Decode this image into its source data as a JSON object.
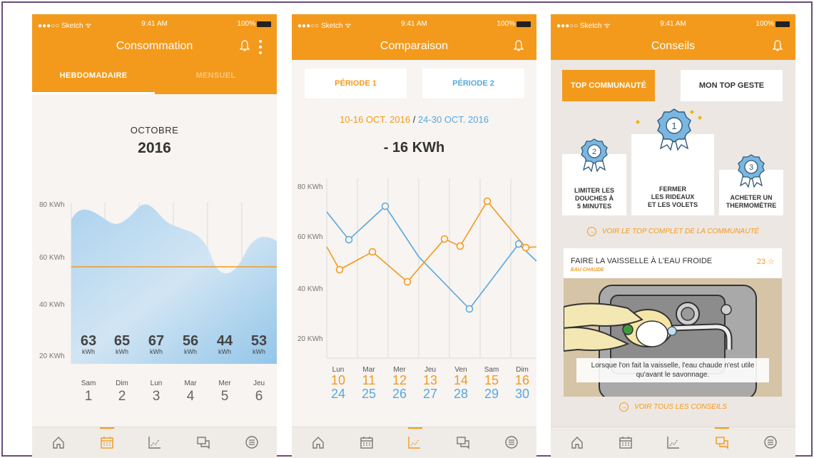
{
  "status_bar": {
    "carrier": "●●●○○ Sketch ᯤ",
    "time": "9:41 AM",
    "battery": "100%"
  },
  "screen1": {
    "title": "Consommation",
    "tab_weekly": "HEBDOMADAIRE",
    "tab_monthly": "MENSUEL",
    "month": "OCTOBRE",
    "year": "2016",
    "y_labels": [
      "80 KWh",
      "60 KWh",
      "40 KWh",
      "20 KWh"
    ],
    "values": [
      {
        "n": "63",
        "u": "kWh"
      },
      {
        "n": "65",
        "u": "kWh"
      },
      {
        "n": "67",
        "u": "kWh"
      },
      {
        "n": "56",
        "u": "kWh"
      },
      {
        "n": "44",
        "u": "kWh"
      },
      {
        "n": "53",
        "u": "kWh"
      }
    ],
    "days": [
      {
        "d": "Sam",
        "n": "1"
      },
      {
        "d": "Dim",
        "n": "2"
      },
      {
        "d": "Lun",
        "n": "3"
      },
      {
        "d": "Mar",
        "n": "4"
      },
      {
        "d": "Mer",
        "n": "5"
      },
      {
        "d": "Jeu",
        "n": "6"
      }
    ]
  },
  "screen2": {
    "title": "Comparaison",
    "period1": "PÉRIODE 1",
    "period2": "PÉRIODE 2",
    "date1": "10-16 OCT. 2016",
    "sep": " / ",
    "date2": "24-30 OCT. 2016",
    "delta": "- 16 KWh",
    "y_labels": [
      "80 KWh",
      "60 KWh",
      "40 KWh",
      "20 KWh"
    ],
    "days": [
      {
        "d": "Lun",
        "a": "10",
        "b": "24"
      },
      {
        "d": "Mar",
        "a": "11",
        "b": "25"
      },
      {
        "d": "Mer",
        "a": "12",
        "b": "26"
      },
      {
        "d": "Jeu",
        "a": "13",
        "b": "27"
      },
      {
        "d": "Ven",
        "a": "14",
        "b": "28"
      },
      {
        "d": "Sam",
        "a": "15",
        "b": "29"
      },
      {
        "d": "Dim",
        "a": "16",
        "b": "30"
      }
    ]
  },
  "screen3": {
    "title": "Conseils",
    "btn_top_community": "TOP COMMUNAUTÉ",
    "btn_my_top": "MON TOP GESTE",
    "rank1": "1",
    "rank2": "2",
    "rank3": "3",
    "card1": "FERMER\nLES RIDEAUX\nET LES VOLETS",
    "card2": "LIMITER LES\nDOUCHES À\n5 MINUTES",
    "card3": "ACHETER UN\nTHERMOMÈTRE",
    "link_top": "VOIR LE TOP COMPLET DE LA COMMUNAUTÉ",
    "tip_title": "FAIRE LA VAISSELLE À L'EAU FROIDE",
    "tip_sub": "EAU CHAUDE",
    "tip_score": "23 ☆",
    "tip_caption": "Lorsque l'on fait la vaisselle, l'eau chaude n'est utile qu'avant le savonnage.",
    "link_all": "VOIR TOUS LES CONSEILS"
  },
  "colors": {
    "accent": "#f39a1c",
    "blue": "#5aa8dc",
    "background": "#f7f4f1"
  },
  "nav_icons": [
    "home-icon",
    "calendar-icon",
    "chart-icon",
    "chat-icon",
    "menu-icon"
  ]
}
